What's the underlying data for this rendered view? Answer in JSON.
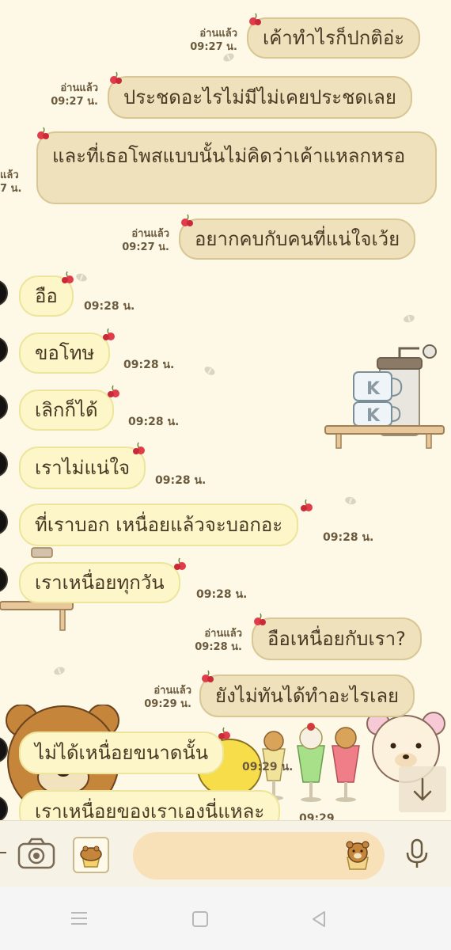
{
  "messages": [
    {
      "side": "sent",
      "text": "เค้าทำไรก็ปกติอ่ะ",
      "read": "อ่านแล้ว",
      "time": "09:27 น."
    },
    {
      "side": "sent",
      "text": "ประชดอะไรไม่มีไม่เคยประชดเลย",
      "read": "อ่านแล้ว",
      "time": "09:27 น."
    },
    {
      "side": "sent",
      "text": "และที่เธอโพสแบบนั้นไม่คิดว่าเค้าแหลกหรอ",
      "read": "แล้ว",
      "time": "7 น."
    },
    {
      "side": "sent",
      "text": "อยากคบกับคนที่แน่ใจเว้ย",
      "read": "อ่านแล้ว",
      "time": "09:27 น."
    },
    {
      "side": "recv",
      "text": "อือ",
      "time": "09:28 น."
    },
    {
      "side": "recv",
      "text": "ขอโทษ",
      "time": "09:28 น."
    },
    {
      "side": "recv",
      "text": "เลิกก็ได้",
      "time": "09:28 น."
    },
    {
      "side": "recv",
      "text": "เราไม่แน่ใจ",
      "time": "09:28 น."
    },
    {
      "side": "recv",
      "text": "ที่เราบอก เหนื่อยแล้วจะบอกอะ",
      "time": "09:28 น."
    },
    {
      "side": "recv",
      "text": "เราเหนื่อยทุกวัน",
      "time": "09:28 น."
    },
    {
      "side": "sent",
      "text": "อือเหนื่อยกับเรา?",
      "read": "อ่านแล้ว",
      "time": "09:28 น."
    },
    {
      "side": "sent",
      "text": "ยังไม่ทันได้ทำอะไรเลย",
      "read": "อ่านแล้ว",
      "time": "09:29 น."
    },
    {
      "side": "recv",
      "text": "ไม่ได้เหนื่อยขนาดนั้น",
      "time": "09:29 น."
    },
    {
      "side": "recv",
      "text": "เราเหนื่อยของเราเองนี่แหละ",
      "time": "09:29"
    }
  ],
  "icons": {
    "camera": "camera-icon",
    "sticker": "muffin-sticker-icon",
    "emoji": "bear-muffin-icon",
    "mic": "microphone-icon",
    "scroll": "arrow-down-icon",
    "plus": "plus-icon",
    "nav_menu": "menu-icon",
    "nav_home": "home-icon",
    "nav_back": "back-icon"
  },
  "colors": {
    "background": "#fdf9e6",
    "sent_bubble": "#efe1bc",
    "received_bubble": "#fcf6c9",
    "text": "#4a3a25",
    "meta": "#6b5a3d"
  }
}
